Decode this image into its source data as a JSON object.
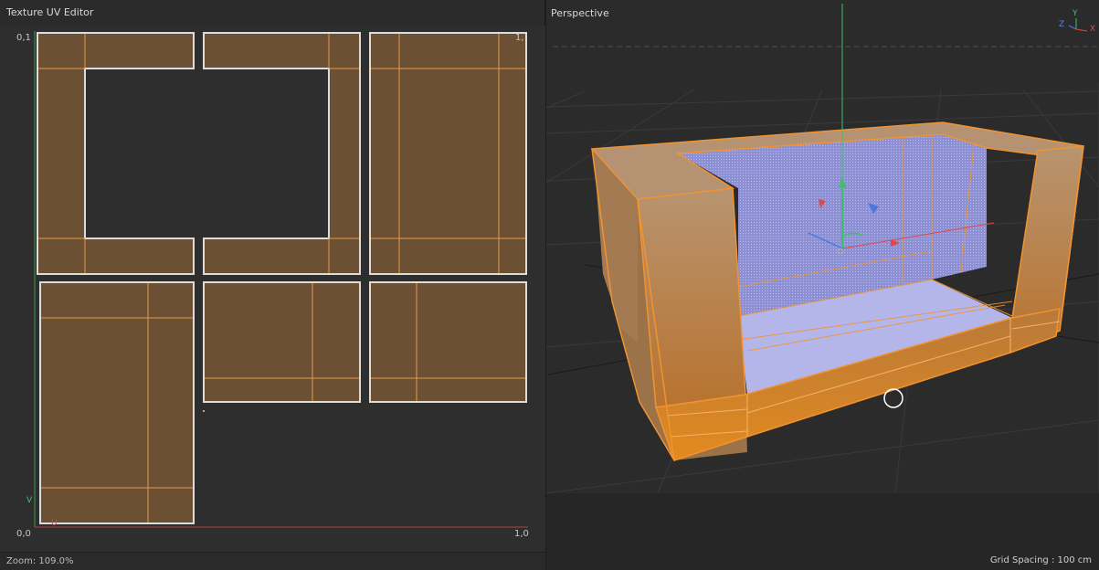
{
  "uv_editor": {
    "title": "Texture UV Editor",
    "corners": {
      "top_left": "0,1",
      "top_right": "1,",
      "bottom_left": "0,0",
      "bottom_right": "1,0"
    },
    "axis_labels": {
      "v": "V",
      "u": "U"
    },
    "status": "Zoom: 109.0%"
  },
  "viewport": {
    "title": "Perspective",
    "grid_spacing": "Grid Spacing : 100 cm",
    "axis_gizmo": {
      "y": "Y",
      "z": "Z",
      "x": "X"
    }
  },
  "colors": {
    "uv_face": "#6b5034",
    "uv_edge": "#e79a4a",
    "uv_border": "#d9d9d9",
    "selection": "#f09330",
    "interior_blue": "#8f92d8",
    "axis_x": "#e04848",
    "axis_y": "#3fbf6a",
    "axis_z": "#4a78e0"
  }
}
